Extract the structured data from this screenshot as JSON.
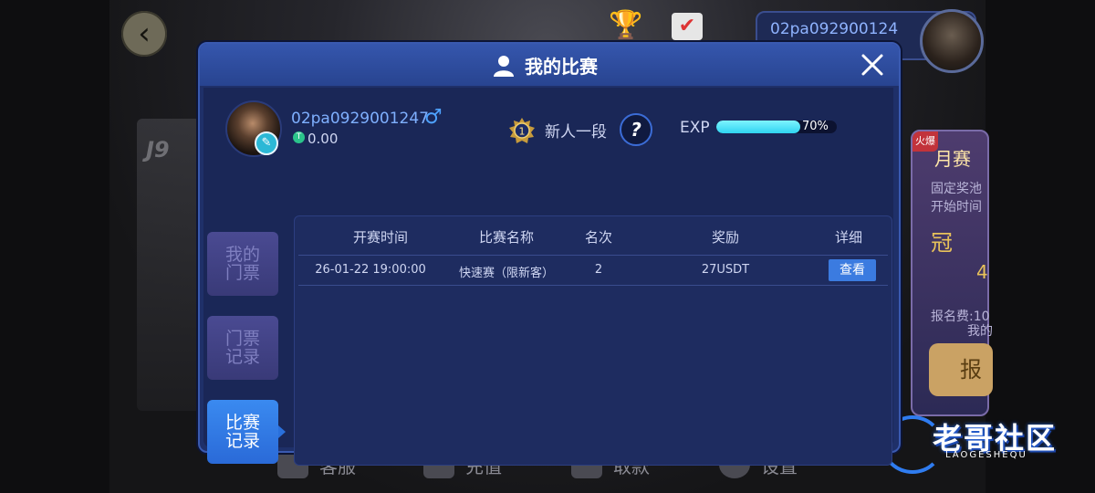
{
  "background": {
    "top_user_name": "02pa092900124",
    "month_card": {
      "tag": "火爆",
      "title": "月赛",
      "line1": "固定奖池",
      "line2": "开始时间",
      "line3": "冠",
      "line4": "4",
      "line5": "报名费:10",
      "line6": "我的",
      "signup_label": "报"
    },
    "bottom_nav": [
      "客服",
      "充值",
      "取款",
      "设置"
    ],
    "watermark_main": "老哥社区",
    "watermark_sub": "LAOGESHEQU"
  },
  "modal": {
    "title": "我的比赛",
    "profile": {
      "name": "02pa0929001247",
      "gender_symbol": "♂",
      "balance": "0.00",
      "rank_number": "1",
      "rank_label": "新人一段",
      "help_symbol": "?",
      "exp_label": "EXP",
      "exp_percent_text": "70%",
      "exp_fraction": 0.7
    },
    "tabs": [
      {
        "label": "我的\n门票",
        "active": false
      },
      {
        "label": "门票\n记录",
        "active": false
      },
      {
        "label": "比赛\n记录",
        "active": true
      }
    ],
    "table": {
      "headers": [
        "开赛时间",
        "比赛名称",
        "名次",
        "奖励",
        "详细"
      ],
      "rows": [
        {
          "time": "26-01-22 19:00:00",
          "name": "快速赛（限新客）",
          "rank": "2",
          "reward": "27USDT",
          "action": "查看"
        }
      ]
    }
  },
  "colors": {
    "modal_bg": "#1a2757",
    "header_bg": "#3556ad",
    "accent_blue": "#3b7be0",
    "exp_fill": "#2fd4f0",
    "name_blue": "#7fb0ff"
  }
}
